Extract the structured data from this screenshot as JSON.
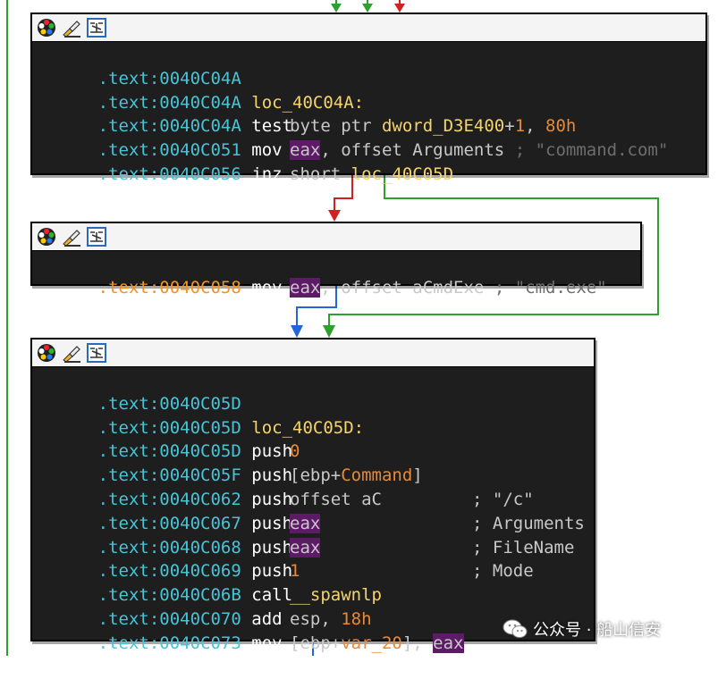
{
  "colors": {
    "block_bg": "#1e1e1e",
    "address": "#49c3d6",
    "address_selected": "#f59220",
    "label": "#f5d46b",
    "number": "#e58a3a",
    "register_highlight": "#5d1a66",
    "edge_true": "#2ea02e",
    "edge_false": "#d02020",
    "edge_uncond": "#2266dd",
    "frame_line": "#2ea02e"
  },
  "header_icons": [
    "color-palette-icon",
    "rename-block-icon",
    "graph-layout-icon"
  ],
  "blocks": [
    {
      "lines": [
        {
          "addr": ".text:0040C04A",
          "label": "",
          "mnem": "",
          "op1": "",
          "op2": "",
          "cmt": ""
        },
        {
          "addr": ".text:0040C04A",
          "label": "loc_40C04A:",
          "mnem": "",
          "op1": "",
          "op2": "",
          "cmt": ""
        },
        {
          "addr": ".text:0040C04A",
          "label": "",
          "mnem": "test",
          "op1": "byte ptr dword_D3E400+1,",
          "op2": "80h",
          "cmt": ""
        },
        {
          "addr": ".text:0040C051",
          "label": "",
          "mnem": "mov",
          "op1": "eax",
          "op2": ", offset Arguments",
          "cmt": "; \"command.com\""
        },
        {
          "addr": ".text:0040C056",
          "label": "",
          "mnem": "jnz",
          "op1": "short",
          "op2": "loc_40C05D",
          "cmt": ""
        }
      ]
    },
    {
      "lines": [
        {
          "addr": ".text:0040C058",
          "label": "",
          "mnem": "mov",
          "op1": "eax",
          "op2": ", offset aCmdExe",
          "cmt": "; \"cmd.exe\""
        }
      ]
    },
    {
      "lines": [
        {
          "addr": ".text:0040C05D"
        },
        {
          "addr": ".text:0040C05D",
          "label": "loc_40C05D:"
        },
        {
          "addr": ".text:0040C05D",
          "mnem": "push",
          "op": "0"
        },
        {
          "addr": ".text:0040C05F",
          "mnem": "push",
          "op_a": "[ebp+",
          "op_b": "Command",
          "op_c": "]"
        },
        {
          "addr": ".text:0040C062",
          "mnem": "push",
          "op": "offset aC",
          "cmt": "; \"/c\""
        },
        {
          "addr": ".text:0040C067",
          "mnem": "push",
          "op": "eax",
          "cmt": "; Arguments"
        },
        {
          "addr": ".text:0040C068",
          "mnem": "push",
          "op": "eax",
          "cmt": "; FileName"
        },
        {
          "addr": ".text:0040C069",
          "mnem": "push",
          "op": "1",
          "cmt": "; Mode"
        },
        {
          "addr": ".text:0040C06B",
          "mnem": "call",
          "op": "__spawnlp"
        },
        {
          "addr": ".text:0040C070",
          "mnem": "add",
          "op_a": "esp, ",
          "op_b": "18h"
        },
        {
          "addr": ".text:0040C073",
          "mnem": "mov",
          "op_a": "[ebp+",
          "op_b": "var_20",
          "op_c": "], ",
          "op_d": "eax"
        }
      ]
    }
  ],
  "watermark": {
    "text": "公众号 · 船山信安"
  }
}
